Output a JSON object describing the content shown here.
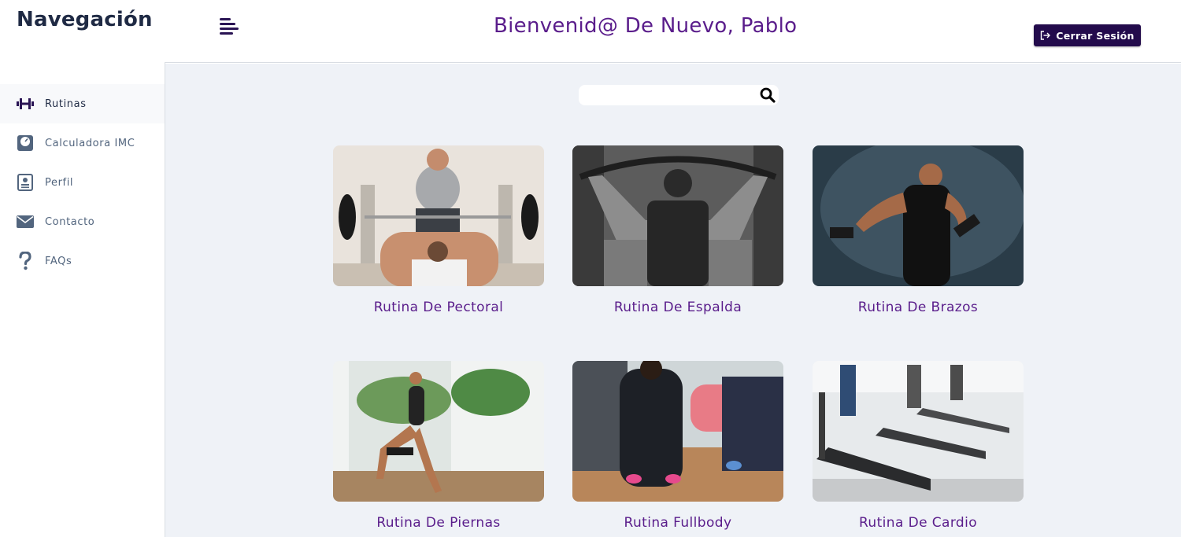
{
  "sidebar": {
    "title": "Navegación",
    "items": [
      {
        "label": "Rutinas",
        "icon": "dumbbell-icon",
        "active": true
      },
      {
        "label": "Calculadora IMC",
        "icon": "scale-icon",
        "active": false
      },
      {
        "label": "Perfil",
        "icon": "profile-card-icon",
        "active": false
      },
      {
        "label": "Contacto",
        "icon": "envelope-icon",
        "active": false
      },
      {
        "label": "FAQs",
        "icon": "question-icon",
        "active": false
      }
    ]
  },
  "header": {
    "welcome": "Bienvenid@ De Nuevo, Pablo",
    "menu_icon": "menu-lines-icon",
    "logout_label": "Cerrar Sesión",
    "logout_icon": "logout-icon"
  },
  "search": {
    "value": "",
    "placeholder": "",
    "icon": "search-icon"
  },
  "cards": [
    {
      "title": "Rutina De Pectoral"
    },
    {
      "title": "Rutina De Espalda"
    },
    {
      "title": "Rutina De Brazos"
    },
    {
      "title": "Rutina De Piernas"
    },
    {
      "title": "Rutina Fullbody"
    },
    {
      "title": "Rutina De Cardio"
    }
  ],
  "colors": {
    "accent": "#5a1d8b",
    "button_bg": "#230b4c",
    "sidebar_text": "#52657e",
    "main_bg": "#eff2f7"
  }
}
